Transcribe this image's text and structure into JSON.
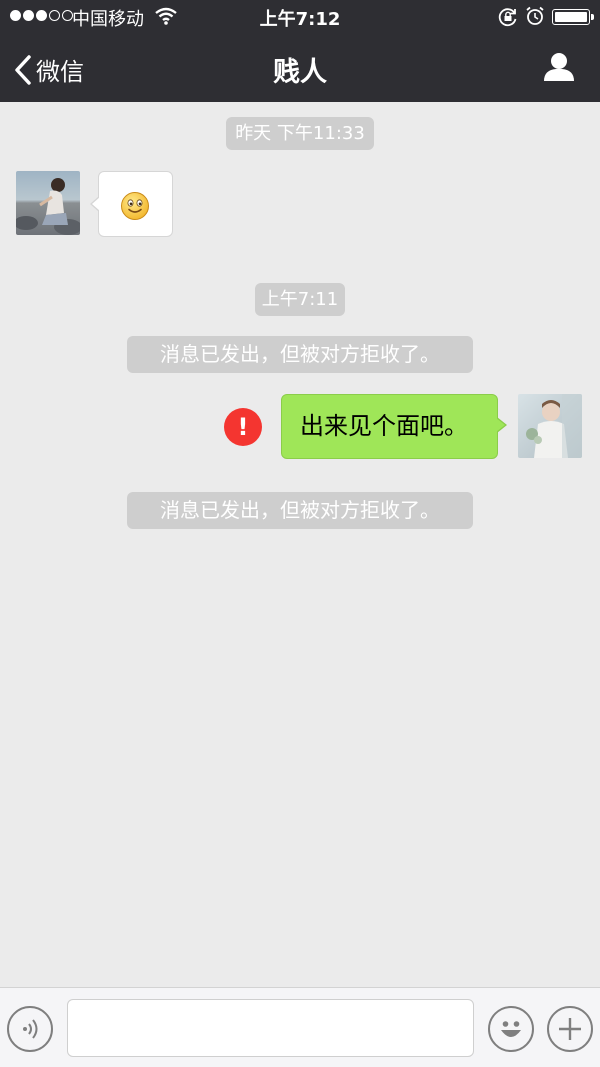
{
  "status_bar": {
    "signal_dots_filled": 3,
    "signal_dots_total": 5,
    "carrier": "中国移动",
    "time": "上午7:12",
    "icons": [
      "wifi-icon",
      "rotation-lock-icon",
      "alarm-icon",
      "battery-icon"
    ]
  },
  "nav": {
    "back_label": "微信",
    "title": "贱人",
    "icons": [
      "chevron-left-icon",
      "profile-icon"
    ]
  },
  "messages": [
    {
      "type": "timestamp",
      "text": "昨天 下午11:33"
    },
    {
      "type": "incoming",
      "content": "smile-emoji"
    },
    {
      "type": "timestamp",
      "text": "上午7:11"
    },
    {
      "type": "system",
      "text": "消息已发出，但被对方拒收了。"
    },
    {
      "type": "outgoing",
      "text": "出来见个面吧。",
      "status": "failed"
    },
    {
      "type": "system",
      "text": "消息已发出，但被对方拒收了。"
    }
  ],
  "input_bar": {
    "value": "",
    "icons": [
      "voice-icon",
      "emoji-icon",
      "plus-icon"
    ]
  },
  "colors": {
    "nav_background": "#2e2e33",
    "chat_background": "#ebebeb",
    "outgoing_bubble": "#9fe658",
    "error_badge": "#f43530",
    "pill_background": "#cecece"
  }
}
